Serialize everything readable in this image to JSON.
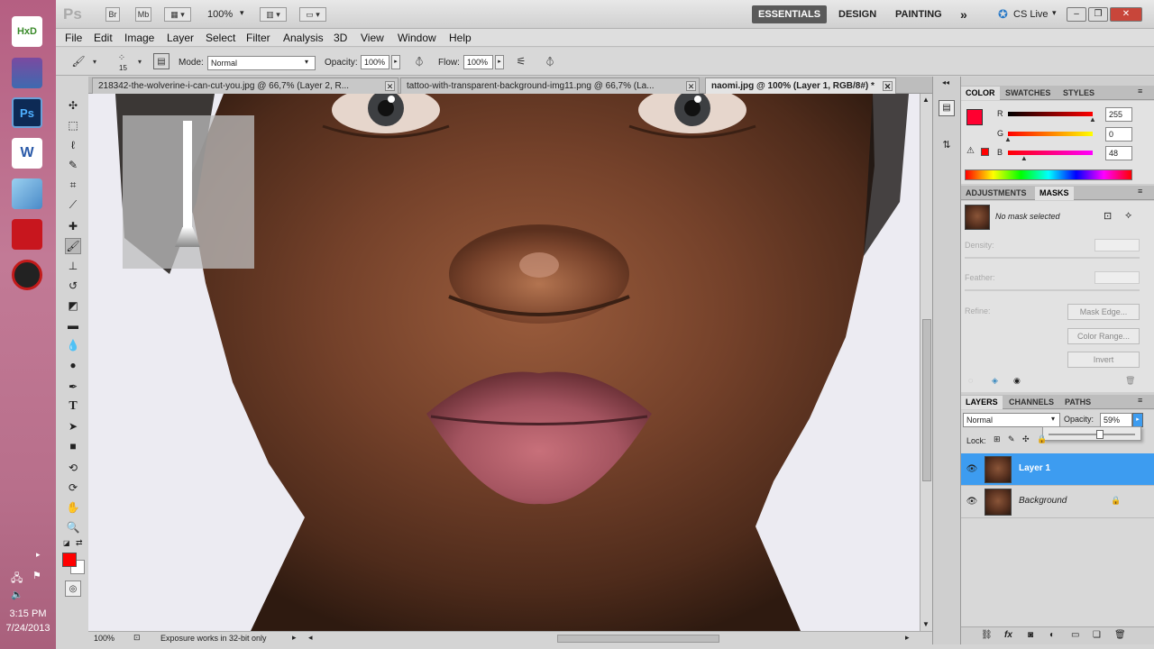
{
  "taskbar": {
    "icons": [
      {
        "name": "hxd-icon",
        "label": "HxD"
      },
      {
        "name": "winrar-icon",
        "label": ""
      },
      {
        "name": "photoshop-taskbar-icon",
        "label": "Ps"
      },
      {
        "name": "word-icon",
        "label": "W"
      },
      {
        "name": "vm-icon",
        "label": ""
      },
      {
        "name": "acrobat-icon",
        "label": ""
      },
      {
        "name": "mediaplayer-icon",
        "label": ""
      }
    ],
    "time": "3:15 PM",
    "date": "7/24/2013"
  },
  "titlebar": {
    "logo": "Ps",
    "bridge": "Br",
    "minibridge": "Mb",
    "zoom": "100%",
    "workspaces": [
      "ESSENTIALS",
      "DESIGN",
      "PAINTING"
    ],
    "more": "»",
    "cslive": "CS Live"
  },
  "menu": [
    "File",
    "Edit",
    "Image",
    "Layer",
    "Select",
    "Filter",
    "Analysis",
    "3D",
    "View",
    "Window",
    "Help"
  ],
  "options": {
    "brush_size": "15",
    "mode_label": "Mode:",
    "mode_value": "Normal",
    "opacity_label": "Opacity:",
    "opacity_value": "100%",
    "flow_label": "Flow:",
    "flow_value": "100%"
  },
  "tabs": [
    {
      "label": "218342-the-wolverine-i-can-cut-you.jpg @ 66,7% (Layer 2, R...",
      "active": false
    },
    {
      "label": "tattoo-with-transparent-background-img11.png @ 66,7% (La...",
      "active": false
    },
    {
      "label": "naomi.jpg @ 100% (Layer 1, RGB/8#) *",
      "active": true
    }
  ],
  "status": {
    "zoom": "100%",
    "message": "Exposure works in 32-bit only"
  },
  "color_panel": {
    "tabs": [
      "COLOR",
      "SWATCHES",
      "STYLES"
    ],
    "r_label": "R",
    "r_value": "255",
    "r_fraction": 1.0,
    "g_label": "G",
    "g_value": "0",
    "g_fraction": 0.0,
    "b_label": "B",
    "b_value": "48",
    "b_fraction": 0.19,
    "foreground": "#ff0030"
  },
  "masks_panel": {
    "tabs": [
      "ADJUSTMENTS",
      "MASKS"
    ],
    "status": "No mask selected",
    "density": "Density:",
    "feather": "Feather:",
    "refine": "Refine:",
    "mask_edge": "Mask Edge...",
    "color_range": "Color Range...",
    "invert": "Invert"
  },
  "layers_panel": {
    "tabs": [
      "LAYERS",
      "CHANNELS",
      "PATHS"
    ],
    "blend": "Normal",
    "opacity_label": "Opacity:",
    "opacity_value": "59%",
    "opacity_fraction": 0.59,
    "lock_label": "Lock:",
    "layers": [
      {
        "name": "Layer 1",
        "selected": true
      },
      {
        "name": "Background",
        "selected": false
      }
    ]
  },
  "colors": {
    "accent_selected": "#3d9cf0",
    "foreground_swatch": "#ff0000"
  }
}
